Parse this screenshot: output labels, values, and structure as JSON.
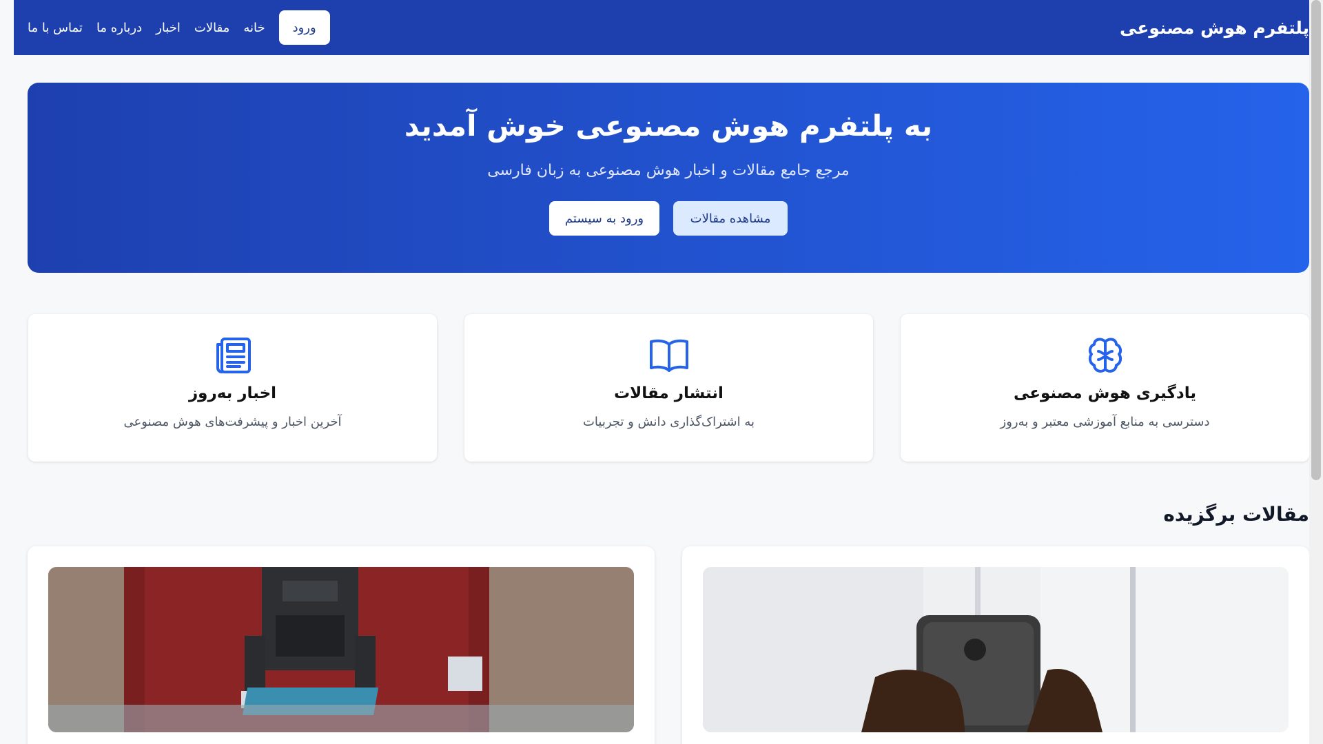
{
  "navbar": {
    "brand": "پلتفرم هوش مصنوعی",
    "links": [
      "خانه",
      "مقالات",
      "اخبار",
      "درباره ما",
      "تماس با ما"
    ],
    "login_label": "ورود"
  },
  "hero": {
    "title": "به پلتفرم هوش مصنوعی خوش آمدید",
    "subtitle": "مرجع جامع مقالات و اخبار هوش مصنوعی به زبان فارسی",
    "primary_button": "مشاهده مقالات",
    "secondary_button": "ورود به سیستم"
  },
  "features": [
    {
      "icon": "brain-icon",
      "title": "یادگیری هوش مصنوعی",
      "desc": "دسترسی به منابع آموزشی معتبر و به‌روز"
    },
    {
      "icon": "book-icon",
      "title": "انتشار مقالات",
      "desc": "به اشتراک‌گذاری دانش و تجربیات"
    },
    {
      "icon": "newspaper-icon",
      "title": "اخبار به‌روز",
      "desc": "آخرین اخبار و پیشرفت‌های هوش مصنوعی"
    }
  ],
  "featured_section": {
    "title": "مقالات برگزیده"
  },
  "colors": {
    "primary": "#1e40af",
    "accent": "#2563eb",
    "icon": "#2563eb"
  }
}
